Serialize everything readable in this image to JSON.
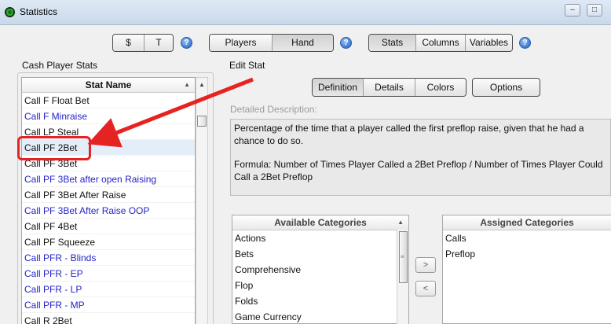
{
  "window": {
    "title": "Statistics",
    "minimize": "–",
    "maximize": "□"
  },
  "top_toolbar": {
    "group1": [
      "$",
      "T"
    ],
    "group2": [
      "Players",
      "Hand"
    ],
    "group3": [
      "Stats",
      "Columns",
      "Variables"
    ],
    "help": "?"
  },
  "left_panel": {
    "title": "Cash Player Stats",
    "column_header": "Stat Name",
    "rows": [
      {
        "label": "Call F Float Bet",
        "color": "dark"
      },
      {
        "label": "Call F Minraise",
        "color": "blue"
      },
      {
        "label": "Call LP Steal",
        "color": "dark"
      },
      {
        "label": "Call PF 2Bet",
        "color": "dark",
        "selected": true
      },
      {
        "label": "Call PF 3Bet",
        "color": "dark"
      },
      {
        "label": "Call PF 3Bet after open Raising",
        "color": "blue"
      },
      {
        "label": "Call PF 3Bet After Raise",
        "color": "dark"
      },
      {
        "label": "Call PF 3Bet After Raise OOP",
        "color": "blue"
      },
      {
        "label": "Call PF 4Bet",
        "color": "dark"
      },
      {
        "label": "Call PF Squeeze",
        "color": "dark"
      },
      {
        "label": "Call PFR - Blinds",
        "color": "blue"
      },
      {
        "label": "Call PFR - EP",
        "color": "blue"
      },
      {
        "label": "Call PFR - LP",
        "color": "blue"
      },
      {
        "label": "Call PFR - MP",
        "color": "blue"
      },
      {
        "label": "Call R 2Bet",
        "color": "dark"
      }
    ]
  },
  "edit_stat": {
    "title": "Edit Stat",
    "tabs": [
      "Definition",
      "Details",
      "Colors"
    ],
    "options_label": "Options",
    "description_label": "Detailed Description:",
    "description_line1": "Percentage of the time that a player called the first preflop raise, given that he had a chance to do so.",
    "description_line2": "Formula: Number of Times Player Called a 2Bet Preflop / Number of Times Player Could Call a 2Bet Preflop",
    "available_header": "Available Categories",
    "available": [
      "Actions",
      "Bets",
      "Comprehensive",
      "Flop",
      "Folds",
      "Game Currency"
    ],
    "assigned_header": "Assigned Categories",
    "assigned": [
      "Calls",
      "Preflop"
    ],
    "move_right": ">",
    "move_left": "<"
  },
  "colors": {
    "accent_red": "#e62323",
    "link_blue": "#2424c8"
  }
}
